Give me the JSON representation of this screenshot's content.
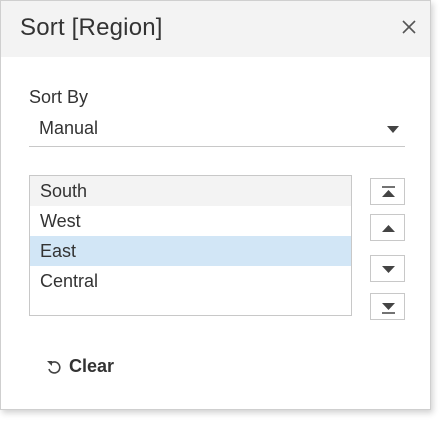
{
  "dialog": {
    "title": "Sort [Region]",
    "close_icon": "close-icon"
  },
  "sort_by": {
    "label": "Sort By",
    "selected": "Manual"
  },
  "list": {
    "items": [
      {
        "label": "South",
        "state": "hover"
      },
      {
        "label": "West",
        "state": "normal"
      },
      {
        "label": "East",
        "state": "selected"
      },
      {
        "label": "Central",
        "state": "normal"
      }
    ]
  },
  "move_buttons": [
    {
      "icon": "move-to-top-icon"
    },
    {
      "icon": "move-up-icon"
    },
    {
      "icon": "move-down-icon"
    },
    {
      "icon": "move-to-bottom-icon"
    }
  ],
  "clear": {
    "label": "Clear",
    "icon": "undo-icon"
  },
  "colors": {
    "header_bg": "#f3f3f3",
    "selected_bg": "#d2e6f6",
    "hover_bg": "#f3f3f3",
    "text": "#333333"
  }
}
